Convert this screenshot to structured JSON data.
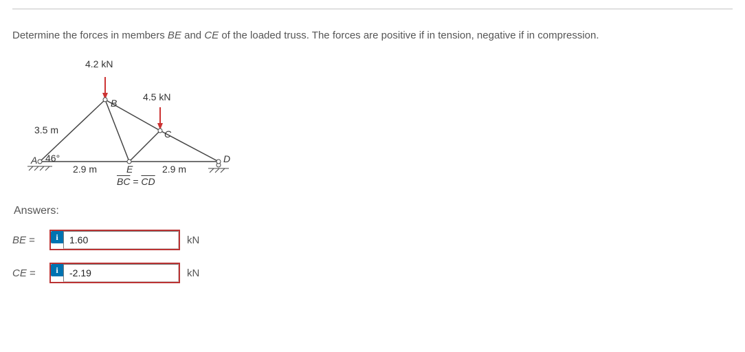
{
  "prompt": {
    "pre": "Determine the forces in members ",
    "m1": "BE",
    "mid": " and ",
    "m2": "CE",
    "post": " of the loaded truss. The forces are positive if in tension, negative if in compression."
  },
  "diagram": {
    "load_top": "4.2 kN",
    "load_right": "4.5 kN",
    "len_left": "3.5 m",
    "angle": "46°",
    "seg_left": "2.9 m",
    "seg_right": "2.9 m",
    "note": "BC = CD",
    "points": {
      "A": "A",
      "B": "B",
      "C": "C",
      "D": "D",
      "E": "E"
    }
  },
  "answers_label": "Answers:",
  "rows": {
    "be": {
      "label": "BE",
      "eq": " =",
      "value": "1.60",
      "unit": "kN"
    },
    "ce": {
      "label": "CE",
      "eq": " =",
      "value": "-2.19",
      "unit": "kN"
    }
  }
}
